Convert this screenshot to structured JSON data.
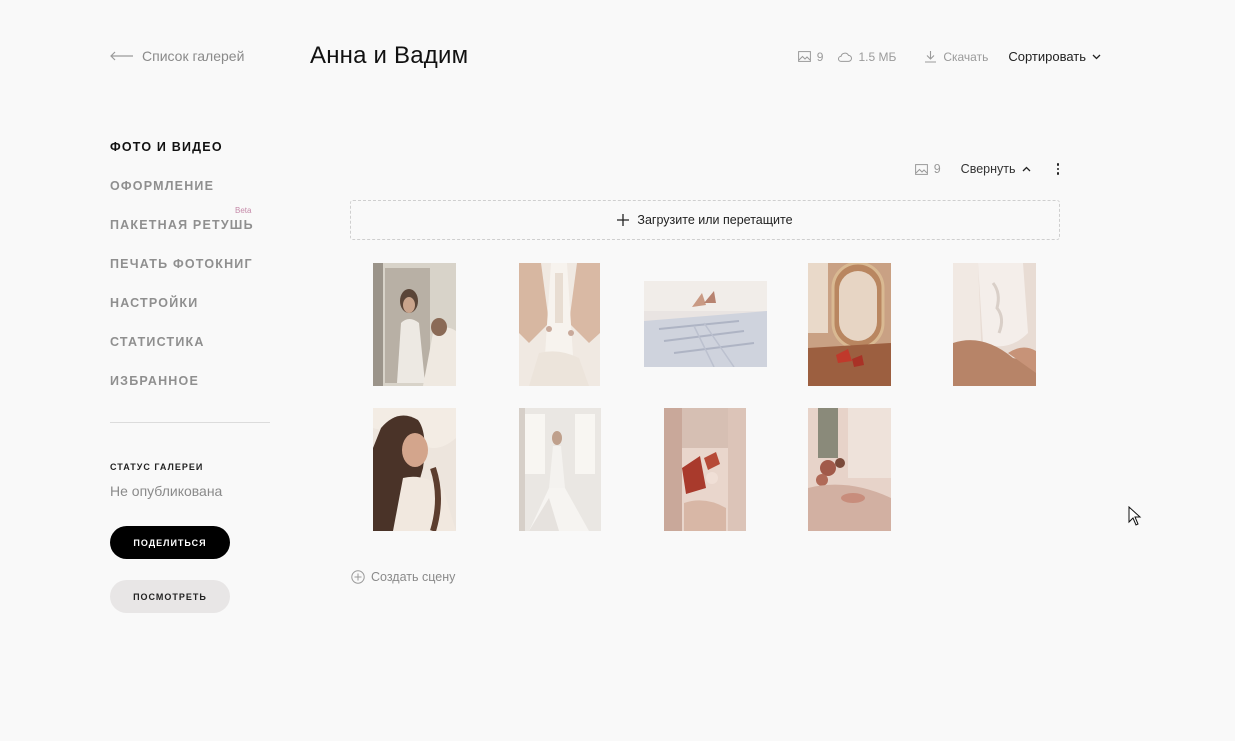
{
  "header": {
    "back_label": "Список галерей",
    "title": "Анна и Вадим",
    "photo_count": "9",
    "size": "1.5 МБ",
    "download_label": "Скачать",
    "sort_label": "Сортировать"
  },
  "sidebar": {
    "items": [
      {
        "label": "ФОТО И ВИДЕО",
        "active": true
      },
      {
        "label": "ОФОРМЛЕНИЕ"
      },
      {
        "label": "ПАКЕТНАЯ РЕТУШЬ",
        "badge": "Beta"
      },
      {
        "label": "ПЕЧАТЬ ФОТОКНИГ"
      },
      {
        "label": "НАСТРОЙКИ"
      },
      {
        "label": "СТАТИСТИКА"
      },
      {
        "label": "ИЗБРАННОЕ"
      }
    ],
    "status_label": "СТАТУС ГАЛЕРЕИ",
    "status_value": "Не опубликована",
    "share_label": "ПОДЕЛИТЬСЯ",
    "view_label": "ПОСМОТРЕТЬ"
  },
  "section": {
    "count": "9",
    "collapse_label": "Свернуть",
    "upload_label": "Загрузите или перетащите",
    "create_scene_label": "Создать сцену"
  },
  "photos": [
    {
      "name": "bride-mirror-portrait"
    },
    {
      "name": "dress-lacing-back"
    },
    {
      "name": "bridal-shoes-on-rug"
    },
    {
      "name": "shoes-by-mirror"
    },
    {
      "name": "lace-back-detail"
    },
    {
      "name": "bride-smiling-profile"
    },
    {
      "name": "bride-at-window"
    },
    {
      "name": "red-shoes-detail"
    },
    {
      "name": "decor-still-life"
    }
  ],
  "colors": {
    "background": "#f9f9f9",
    "accent": "#000000",
    "beta": "#c58aa9",
    "muted": "#8a8a8a"
  }
}
